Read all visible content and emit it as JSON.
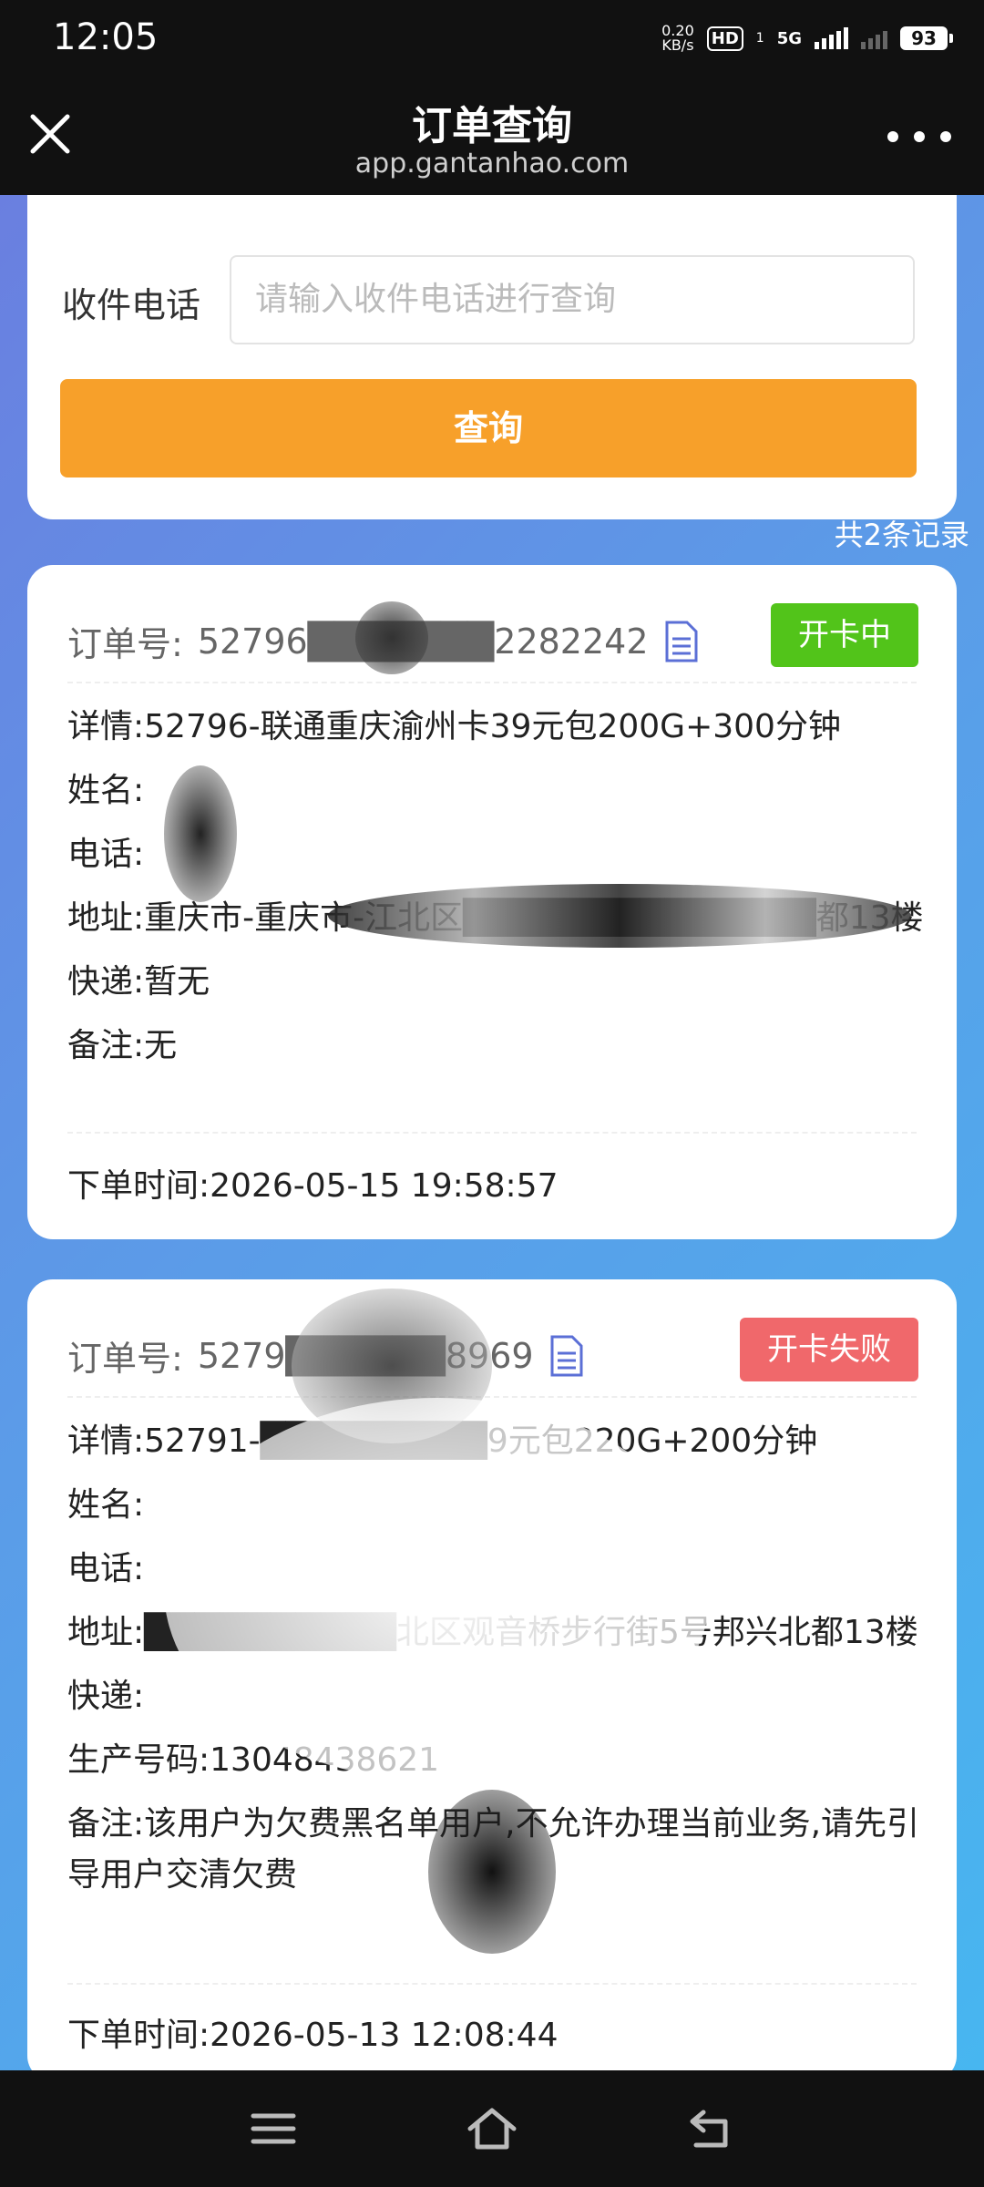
{
  "status": {
    "time": "12:05",
    "net_speed": "0.20",
    "net_unit": "KB/s",
    "hd": "HD",
    "hd_sub": "1",
    "signal": "5G",
    "battery": "93"
  },
  "header": {
    "title": "订单查询",
    "subtitle": "app.gantanhao.com"
  },
  "search": {
    "label": "收件电话",
    "placeholder": "请输入收件电话进行查询",
    "button": "查询",
    "records": "共2条记录"
  },
  "orders": [
    {
      "order_no_label": "订单号:",
      "order_no": "52796███████2282242",
      "status": "开卡中",
      "status_color": "#52c41a",
      "rows": [
        {
          "k": "详情:",
          "v": "52796-联通重庆渝州卡39元包200G+300分钟"
        },
        {
          "k": "姓名:",
          "v": ""
        },
        {
          "k": "电话:",
          "v": ""
        },
        {
          "k": "地址:",
          "v": "重庆市-重庆市-江北区██████████████都13楼"
        },
        {
          "k": "快递:",
          "v": "暂无"
        },
        {
          "k": "备注:",
          "v": "无"
        }
      ],
      "time_label": "下单时间:",
      "time": "2026-05-15 19:58:57"
    },
    {
      "order_no_label": "订单号:",
      "order_no": "5279██████8969",
      "status": "开卡失败",
      "status_color": "#f0686b",
      "rows": [
        {
          "k": "详情:",
          "v": "52791-█████████9元包220G+200分钟"
        },
        {
          "k": "姓名:",
          "v": ""
        },
        {
          "k": "电话:",
          "v": ""
        },
        {
          "k": "地址:",
          "v": "██████████北区观音桥步行街5号邦兴北都13楼"
        },
        {
          "k": "快递:",
          "v": ""
        },
        {
          "k": "生产号码:",
          "v": "13048438621"
        },
        {
          "k": "备注:",
          "v": "该用户为欠费黑名单用户,不允许办理当前业务,请先引导用户交清欠费"
        }
      ],
      "time_label": "下单时间:",
      "time": "2026-05-13 12:08:44"
    }
  ]
}
